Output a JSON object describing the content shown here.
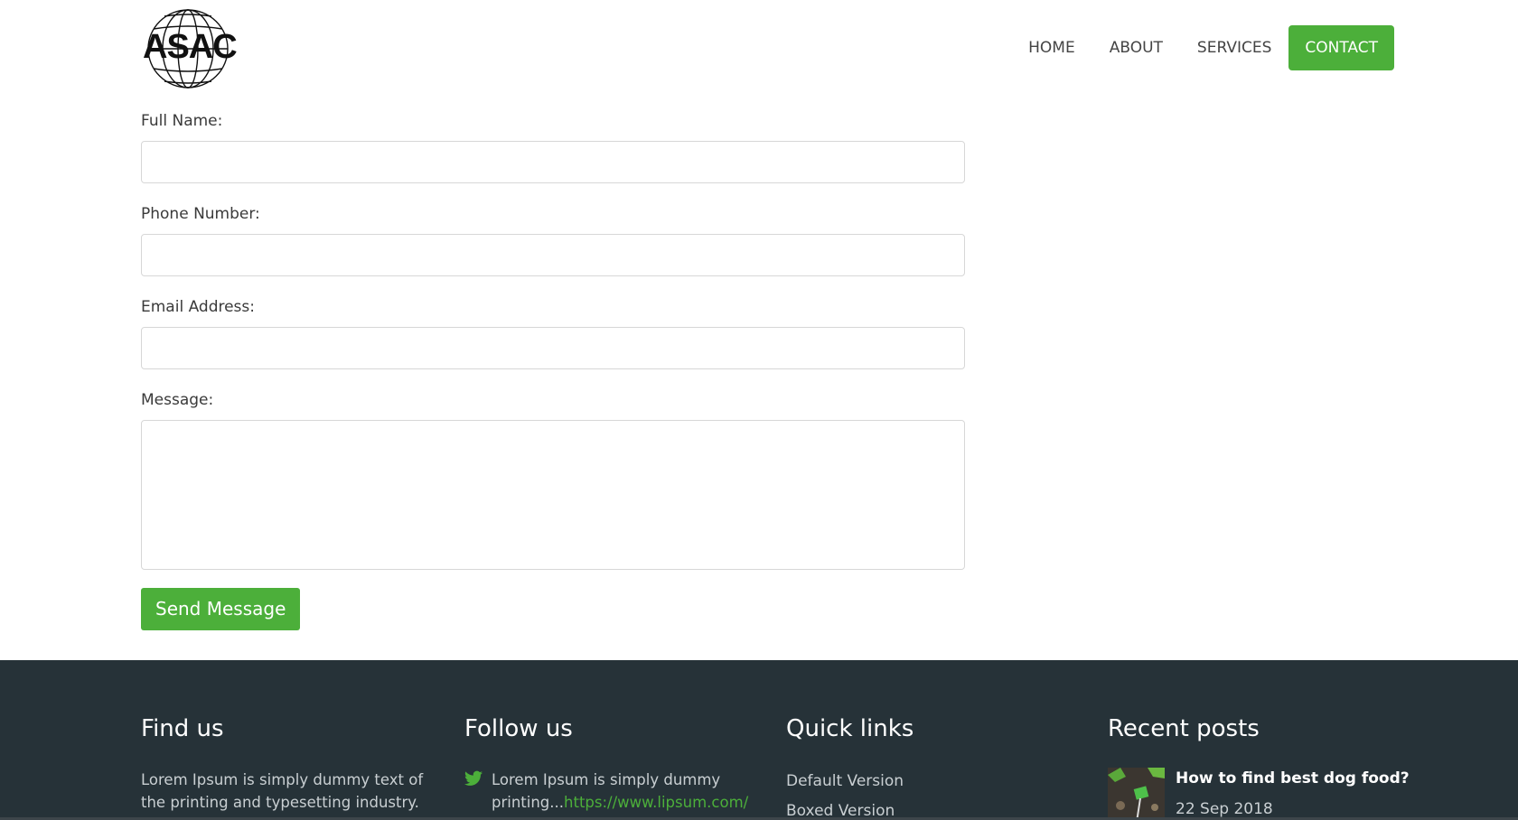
{
  "brand": {
    "logo_text": "ASAC",
    "accent": "#4caf3a",
    "footer_bg": "#263238"
  },
  "nav": {
    "items": [
      {
        "label": "HOME"
      },
      {
        "label": "ABOUT"
      },
      {
        "label": "SERVICES"
      },
      {
        "label": "CONTACT",
        "active": true
      }
    ]
  },
  "form": {
    "full_name_label": "Full Name:",
    "full_name_value": "",
    "phone_label": "Phone Number:",
    "phone_value": "",
    "email_label": "Email Address:",
    "email_value": "",
    "message_label": "Message:",
    "message_value": "",
    "submit_label": "Send Message"
  },
  "footer": {
    "find_us": {
      "heading": "Find us",
      "text": "Lorem Ipsum is simply dummy text of the printing and typesetting industry."
    },
    "follow_us": {
      "heading": "Follow us",
      "icon": "twitter-icon",
      "text": "Lorem Ipsum is simply dummy printing...",
      "link": "https://www.lipsum.com/"
    },
    "quick_links": {
      "heading": "Quick links",
      "items": [
        "Default Version",
        "Boxed Version"
      ]
    },
    "recent_posts": {
      "heading": "Recent posts",
      "post_title": "How to find best dog food?",
      "post_date": "22 Sep 2018"
    }
  }
}
